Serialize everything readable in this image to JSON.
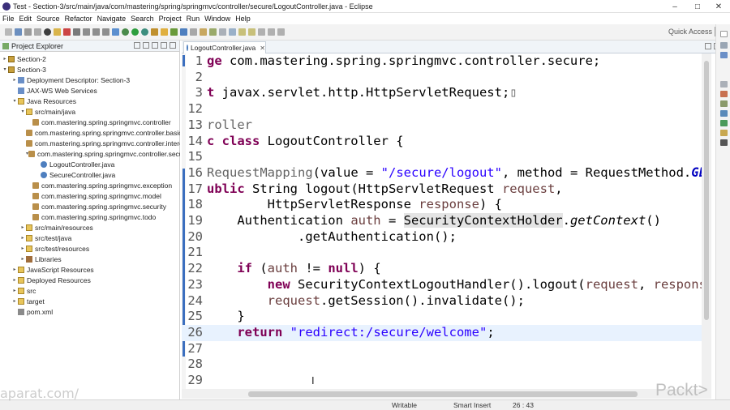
{
  "window": {
    "title": "Test - Section-3/src/main/java/com/mastering/spring/springmvc/controller/secure/LogoutController.java - Eclipse",
    "minimize": "–",
    "maximize": "□",
    "close": "✕"
  },
  "menu": [
    "File",
    "Edit",
    "Source",
    "Refactor",
    "Navigate",
    "Search",
    "Project",
    "Run",
    "Window",
    "Help"
  ],
  "toolbar": {
    "quick_access": "Quick Access"
  },
  "explorer": {
    "title": "Project Explorer",
    "items": [
      {
        "label": "Section-2",
        "twisty": "▸"
      },
      {
        "label": "Section-3",
        "twisty": "▾"
      },
      {
        "label": "Deployment Descriptor: Section-3",
        "twisty": "▸"
      },
      {
        "label": "JAX-WS Web Services",
        "twisty": ""
      },
      {
        "label": "Java Resources",
        "twisty": "▾"
      },
      {
        "label": "src/main/java",
        "twisty": "▾"
      },
      {
        "label": "com.mastering.spring.springmvc.controller",
        "twisty": ""
      },
      {
        "label": "com.mastering.spring.springmvc.controller.basic",
        "twisty": ""
      },
      {
        "label": "com.mastering.spring.springmvc.controller.interceptor",
        "twisty": ""
      },
      {
        "label": "com.mastering.spring.springmvc.controller.secure",
        "twisty": "▾"
      },
      {
        "label": "LogoutController.java",
        "twisty": ""
      },
      {
        "label": "SecureController.java",
        "twisty": ""
      },
      {
        "label": "com.mastering.spring.springmvc.exception",
        "twisty": ""
      },
      {
        "label": "com.mastering.spring.springmvc.model",
        "twisty": ""
      },
      {
        "label": "com.mastering.spring.springmvc.security",
        "twisty": ""
      },
      {
        "label": "com.mastering.spring.springmvc.todo",
        "twisty": ""
      },
      {
        "label": "src/main/resources",
        "twisty": "▸"
      },
      {
        "label": "src/test/java",
        "twisty": "▸"
      },
      {
        "label": "src/test/resources",
        "twisty": "▸"
      },
      {
        "label": "Libraries",
        "twisty": "▸"
      },
      {
        "label": "JavaScript Resources",
        "twisty": "▸"
      },
      {
        "label": "Deployed Resources",
        "twisty": "▸"
      },
      {
        "label": "src",
        "twisty": "▸"
      },
      {
        "label": "target",
        "twisty": "▸"
      },
      {
        "label": "pom.xml",
        "twisty": ""
      }
    ]
  },
  "editor": {
    "tab_label": "LogoutController.java",
    "tab_close": "✕",
    "lines": [
      {
        "n": "1",
        "tokens": [
          {
            "t": "ge ",
            "c": "kw"
          },
          {
            "t": "com.mastering.spring.springmvc.controller.secure;",
            "c": ""
          }
        ]
      },
      {
        "n": "2",
        "tokens": []
      },
      {
        "n": "3",
        "tokens": [
          {
            "t": "t ",
            "c": "kw"
          },
          {
            "t": "javax.servlet.http.HttpServletRequest;",
            "c": ""
          },
          {
            "t": "▯",
            "c": "ann"
          }
        ]
      },
      {
        "n": "12",
        "tokens": []
      },
      {
        "n": "13",
        "tokens": [
          {
            "t": "roller",
            "c": "ann"
          }
        ]
      },
      {
        "n": "14",
        "tokens": [
          {
            "t": "c class ",
            "c": "kw"
          },
          {
            "t": "LogoutController {",
            "c": ""
          }
        ]
      },
      {
        "n": "15",
        "tokens": []
      },
      {
        "n": "16",
        "tokens": [
          {
            "t": "RequestMapping",
            "c": "ann"
          },
          {
            "t": "(value = ",
            "c": ""
          },
          {
            "t": "\"/secure/logout\"",
            "c": "str"
          },
          {
            "t": ", method = RequestMethod.",
            "c": ""
          },
          {
            "t": "GE",
            "c": "enum"
          }
        ]
      },
      {
        "n": "17",
        "tokens": [
          {
            "t": "ublic ",
            "c": "kw"
          },
          {
            "t": "String logout(HttpServletRequest ",
            "c": ""
          },
          {
            "t": "request",
            "c": "param"
          },
          {
            "t": ",",
            "c": ""
          }
        ]
      },
      {
        "n": "18",
        "tokens": [
          {
            "t": "        HttpServletResponse ",
            "c": ""
          },
          {
            "t": "response",
            "c": "param"
          },
          {
            "t": ") {",
            "c": ""
          }
        ]
      },
      {
        "n": "19",
        "tokens": [
          {
            "t": "    Authentication ",
            "c": ""
          },
          {
            "t": "auth",
            "c": "param"
          },
          {
            "t": " = ",
            "c": ""
          },
          {
            "t": "SecurityContextHolder",
            "c": "hl"
          },
          {
            "t": ".",
            "c": ""
          },
          {
            "t": "getContext",
            "c": "it"
          },
          {
            "t": "()",
            "c": ""
          }
        ]
      },
      {
        "n": "20",
        "tokens": [
          {
            "t": "            .getAuthentication();",
            "c": ""
          }
        ]
      },
      {
        "n": "21",
        "tokens": []
      },
      {
        "n": "22",
        "tokens": [
          {
            "t": "    ",
            "c": ""
          },
          {
            "t": "if",
            "c": "kw"
          },
          {
            "t": " (",
            "c": ""
          },
          {
            "t": "auth",
            "c": "param"
          },
          {
            "t": " != ",
            "c": ""
          },
          {
            "t": "null",
            "c": "kw"
          },
          {
            "t": ") {",
            "c": ""
          }
        ]
      },
      {
        "n": "23",
        "tokens": [
          {
            "t": "        ",
            "c": ""
          },
          {
            "t": "new",
            "c": "kw"
          },
          {
            "t": " SecurityContextLogoutHandler().logout(",
            "c": ""
          },
          {
            "t": "request",
            "c": "param"
          },
          {
            "t": ", ",
            "c": ""
          },
          {
            "t": "response",
            "c": "param"
          }
        ]
      },
      {
        "n": "24",
        "tokens": [
          {
            "t": "        ",
            "c": ""
          },
          {
            "t": "request",
            "c": "param"
          },
          {
            "t": ".getSession().invalidate();",
            "c": ""
          }
        ]
      },
      {
        "n": "25",
        "tokens": [
          {
            "t": "    }",
            "c": ""
          }
        ]
      },
      {
        "n": "26",
        "tokens": [
          {
            "t": "    ",
            "c": ""
          },
          {
            "t": "return",
            "c": "kw"
          },
          {
            "t": " ",
            "c": ""
          },
          {
            "t": "\"redirect:/secure/welcome\"",
            "c": "str"
          },
          {
            "t": ";",
            "c": ""
          }
        ],
        "current": true
      },
      {
        "n": "27",
        "tokens": []
      },
      {
        "n": "28",
        "tokens": []
      },
      {
        "n": "29",
        "tokens": []
      }
    ]
  },
  "status": {
    "mode": "Writable",
    "insert": "Smart Insert",
    "position": "26 : 43"
  },
  "watermark": "aparat.com/",
  "brand": "Packt>"
}
